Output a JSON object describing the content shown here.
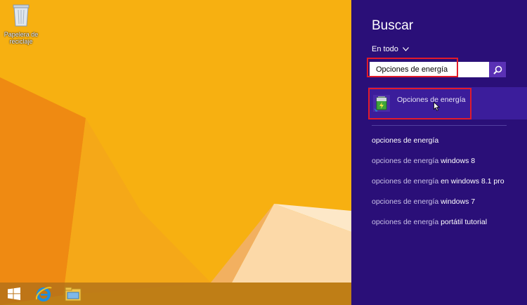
{
  "desktop": {
    "recycle_bin_label": "Papelera de reciclaje"
  },
  "taskbar": {
    "items": [
      "start-icon",
      "internet-explorer-icon",
      "file-explorer-icon"
    ]
  },
  "search_charm": {
    "title": "Buscar",
    "scope": "En todo",
    "query": "Opciones de energía",
    "best_match": "Opciones de energía",
    "suggestion_prefix": "opciones de energía",
    "suggestions": [
      {
        "rest": ""
      },
      {
        "rest": "windows 8"
      },
      {
        "rest": "en windows 8.1 pro"
      },
      {
        "rest": "windows 7"
      },
      {
        "rest": "portátil tutorial"
      }
    ]
  },
  "colors": {
    "charm_bg": "#2a0f78",
    "selected_bg": "#3b1d9b",
    "search_button": "#5a31b5",
    "highlight": "#e21b2a",
    "wallpaper_yellow": "#f7b011"
  }
}
